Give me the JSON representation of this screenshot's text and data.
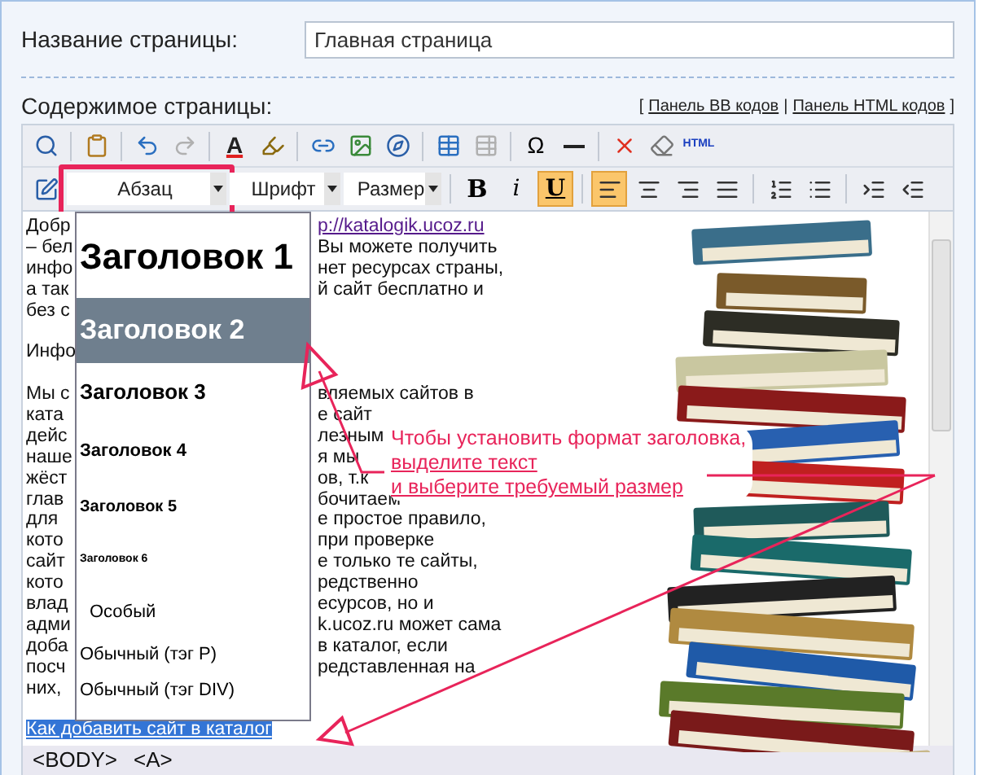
{
  "page_title": {
    "label": "Название страницы:",
    "value": "Главная страница"
  },
  "content": {
    "label": "Содержимое страницы:",
    "open": "[",
    "sep": "|",
    "close": "]",
    "links": [
      "Панель BB кодов",
      "Панель HTML кодов"
    ]
  },
  "toolbar_1": [
    {
      "kind": "preview"
    },
    {
      "kind": "sep"
    },
    {
      "kind": "paste"
    },
    {
      "kind": "sep"
    },
    {
      "kind": "undo",
      "disabled": false
    },
    {
      "kind": "redo",
      "disabled": true
    },
    {
      "kind": "sep"
    },
    {
      "kind": "textcolor",
      "text": "A"
    },
    {
      "kind": "highlight"
    },
    {
      "kind": "sep"
    },
    {
      "kind": "link"
    },
    {
      "kind": "image"
    },
    {
      "kind": "compass"
    },
    {
      "kind": "sep"
    },
    {
      "kind": "table",
      "disabled": false
    },
    {
      "kind": "tableedit",
      "disabled": true
    },
    {
      "kind": "sep"
    },
    {
      "kind": "omega",
      "text": "Ω"
    },
    {
      "kind": "hr"
    },
    {
      "kind": "sep"
    },
    {
      "kind": "remove"
    },
    {
      "kind": "eraser"
    },
    {
      "kind": "html",
      "text": "HTML"
    }
  ],
  "toolbar_2": [
    {
      "kind": "edit"
    },
    {
      "kind": "select",
      "text": "Абзац",
      "marked": true
    },
    {
      "kind": "select",
      "text": "Шрифт"
    },
    {
      "kind": "select",
      "text": "Размер"
    },
    {
      "kind": "sep"
    },
    {
      "kind": "bold",
      "text": "B",
      "active": false
    },
    {
      "kind": "italic",
      "text": "i",
      "active": false
    },
    {
      "kind": "underline",
      "text": "U",
      "active": true
    },
    {
      "kind": "sep"
    },
    {
      "kind": "alignleft",
      "active": true
    },
    {
      "kind": "aligncenter",
      "active": false
    },
    {
      "kind": "alignright",
      "active": false
    },
    {
      "kind": "justify",
      "active": false
    },
    {
      "kind": "sep"
    },
    {
      "kind": "ol",
      "active": false
    },
    {
      "kind": "ul",
      "active": false
    },
    {
      "kind": "sep"
    },
    {
      "kind": "indent",
      "active": false
    },
    {
      "kind": "outdent",
      "active": false
    }
  ],
  "editor_lines": [
    {
      "kind": "link",
      "left": "Добр",
      "right": "p://katalogik.ucoz.ru"
    },
    {
      "kind": "text",
      "left": "– бел",
      "right": "Вы можете получить"
    },
    {
      "kind": "text",
      "left": "инфо",
      "right": "нет ресурсах страны,"
    },
    {
      "kind": "text",
      "left": "а так",
      "right": "й сайт бесплатно и"
    },
    {
      "kind": "text",
      "left": "без с"
    },
    {
      "kind": "blank"
    },
    {
      "kind": "text",
      "left": "Инфо"
    },
    {
      "kind": "blank"
    },
    {
      "kind": "text",
      "left": "Мы с",
      "right": "вляемых сайтов в"
    },
    {
      "kind": "text",
      "left": "ката",
      "right": "е сайт"
    },
    {
      "kind": "text",
      "left": "дейс",
      "right": "лезным"
    },
    {
      "kind": "text",
      "left": "наше",
      "right": "я мы"
    },
    {
      "kind": "text",
      "left": "жёст",
      "right": "ов, т.к"
    },
    {
      "kind": "text",
      "left": "глав",
      "right": "бочитаем"
    },
    {
      "kind": "text",
      "left": "для",
      "right": "е простое правило,"
    },
    {
      "kind": "text",
      "left": "кото",
      "right": "при проверке"
    },
    {
      "kind": "text",
      "left": "сайт",
      "right": "е только те сайты,"
    },
    {
      "kind": "text",
      "left": "кото",
      "right": "редственно"
    },
    {
      "kind": "text",
      "left": "влад",
      "right": "есурсов, но и"
    },
    {
      "kind": "text",
      "left": "адми",
      "right": "k.ucoz.ru может сама"
    },
    {
      "kind": "text",
      "left": "доба",
      "right": "в каталог, если"
    },
    {
      "kind": "text",
      "left": "посч",
      "right": "редставленная на"
    },
    {
      "kind": "text",
      "left": "них,"
    },
    {
      "kind": "blank"
    }
  ],
  "selected_text": "Как добавить сайт в каталог",
  "format_menu": [
    {
      "kind": "h1",
      "label": "Заголовок 1",
      "selected": false
    },
    {
      "kind": "h2",
      "label": "Заголовок 2",
      "selected": true
    },
    {
      "kind": "h3",
      "label": "Заголовок 3",
      "selected": false
    },
    {
      "kind": "h4",
      "label": "Заголовок 4",
      "selected": false
    },
    {
      "kind": "h5",
      "label": "Заголовок 5",
      "selected": false
    },
    {
      "kind": "h6",
      "label": "Заголовок 6",
      "selected": false
    },
    {
      "kind": "special",
      "label": "Особый",
      "selected": false
    },
    {
      "kind": "p",
      "label": "Обычный (тэг P)",
      "selected": false
    },
    {
      "kind": "div",
      "label": "Обычный (тэг DIV)",
      "selected": false
    }
  ],
  "callout": [
    "Чтобы установить формат заголовка,",
    "выделите текст",
    "и выберите требуемый размер"
  ],
  "status_bar": [
    "<BODY>",
    "<A>"
  ]
}
